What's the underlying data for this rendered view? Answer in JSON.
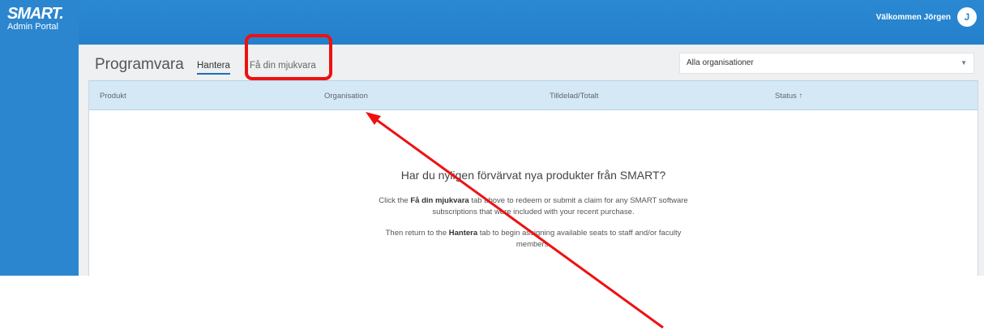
{
  "sidebar": {
    "logo_mark": "SMART.",
    "logo_sub": "Admin Portal"
  },
  "header": {
    "welcome": "Välkommen Jörgen",
    "avatar_initial": "J"
  },
  "page": {
    "title": "Programvara",
    "tabs": [
      {
        "label": "Hantera",
        "active": true
      },
      {
        "label": "Få din mjukvara",
        "active": false
      }
    ],
    "org_select": {
      "value": "Alla organisationer"
    }
  },
  "table": {
    "columns": [
      "Produkt",
      "Organisation",
      "Tilldelad/Totalt",
      "Status"
    ],
    "sort_indicator": "↑"
  },
  "empty_state": {
    "title": "Har du nyligen förvärvat nya produkter från SMART?",
    "p1_pre": "Click the ",
    "p1_bold": "Få din mjukvara",
    "p1_post": " tab above to redeem or submit a claim for any SMART software subscriptions that were included with your recent purchase.",
    "p2_pre": "Then return to the ",
    "p2_bold": "Hantera",
    "p2_post": " tab to begin assigning available seats to staff and/or faculty members."
  },
  "annotation": {
    "color": "#ee1111"
  },
  "colors": {
    "brand_blue": "#2a88d2",
    "table_header": "#d4e8f6",
    "background": "#eef0f1"
  }
}
